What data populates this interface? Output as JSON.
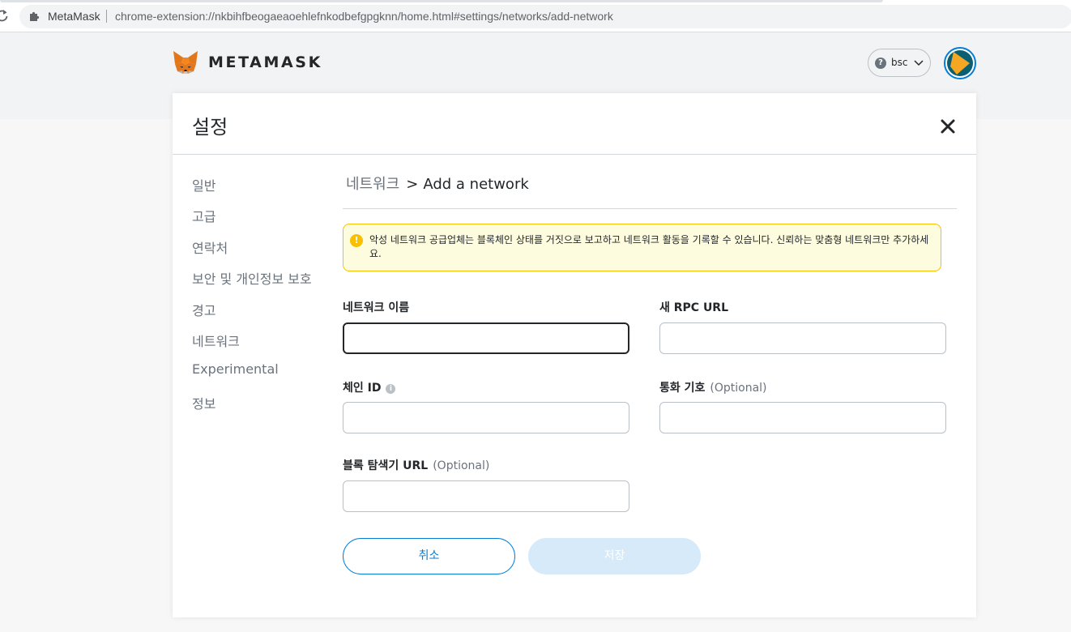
{
  "browser": {
    "tab_label": "MetaMask",
    "url": "chrome-extension://nkbihfbeogaeaoehlefnkodbefgpgknn/home.html#settings/networks/add-network"
  },
  "header": {
    "logo_text": "METAMASK",
    "network_name": "bsc",
    "colors": {
      "avatar_ring": "#037dd6",
      "avatar_fill": "#f5a623",
      "avatar_dark": "#0b5f73"
    }
  },
  "settings": {
    "title": "설정",
    "sidebar": {
      "items": [
        {
          "label": "일반"
        },
        {
          "label": "고급"
        },
        {
          "label": "연락처"
        },
        {
          "label": "보안 및 개인정보 보호"
        },
        {
          "label": "경고"
        },
        {
          "label": "네트워크"
        },
        {
          "label": "Experimental"
        },
        {
          "label": "정보"
        }
      ]
    },
    "breadcrumb": {
      "parent": "네트워크",
      "separator": ">",
      "current": "Add a network"
    },
    "warning": {
      "text": "악성 네트워크 공급업체는 블록체인 상태를 거짓으로 보고하고 네트워크 활동을 기록할 수 있습니다. 신뢰하는 맞춤형 네트워크만 추가하세요.",
      "colors": {
        "bg": "#fefcde",
        "border": "#f8c000"
      }
    },
    "form": {
      "network_name": {
        "label": "네트워크 이름",
        "value": ""
      },
      "rpc_url": {
        "label": "새 RPC URL",
        "value": ""
      },
      "chain_id": {
        "label": "체인 ID",
        "value": ""
      },
      "currency_symbol": {
        "label": "통화 기호",
        "optional": "(Optional)",
        "value": ""
      },
      "explorer_url": {
        "label": "블록 탐색기 URL",
        "optional": "(Optional)",
        "value": ""
      }
    },
    "buttons": {
      "cancel": "취소",
      "save": "저장"
    }
  }
}
